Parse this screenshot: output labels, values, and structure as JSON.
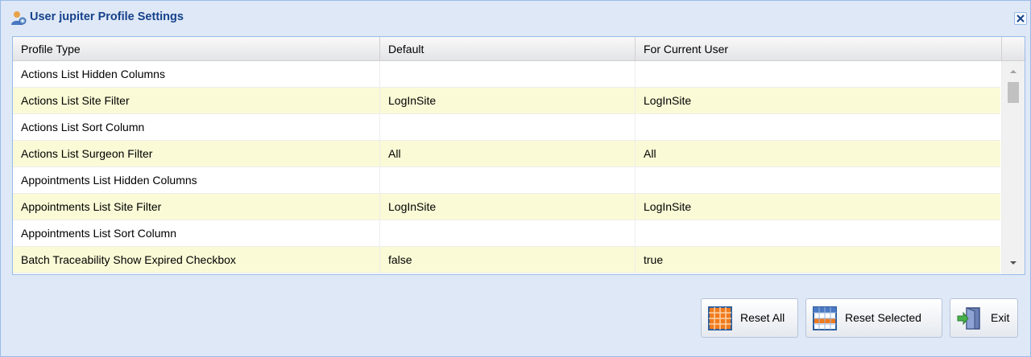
{
  "window": {
    "title": "User jupiter Profile Settings"
  },
  "grid": {
    "columns": [
      "Profile Type",
      "Default",
      "For Current User"
    ],
    "rows": [
      {
        "type": "Actions List Hidden Columns",
        "default": "",
        "current": ""
      },
      {
        "type": "Actions List Site Filter",
        "default": "LogInSite",
        "current": "LogInSite"
      },
      {
        "type": "Actions List Sort Column",
        "default": "",
        "current": ""
      },
      {
        "type": "Actions List Surgeon Filter",
        "default": "All",
        "current": "All"
      },
      {
        "type": "Appointments List Hidden Columns",
        "default": "",
        "current": ""
      },
      {
        "type": "Appointments List Site Filter",
        "default": "LogInSite",
        "current": "LogInSite"
      },
      {
        "type": "Appointments List Sort Column",
        "default": "",
        "current": ""
      },
      {
        "type": "Batch Traceability Show Expired Checkbox",
        "default": "false",
        "current": "true"
      }
    ]
  },
  "buttons": {
    "reset_all": "Reset All",
    "reset_selected": "Reset Selected",
    "exit": "Exit"
  },
  "colors": {
    "title_text": "#15428b",
    "panel_bg": "#dfe8f6",
    "alt_row": "#fafad6",
    "border": "#99bbe8"
  }
}
